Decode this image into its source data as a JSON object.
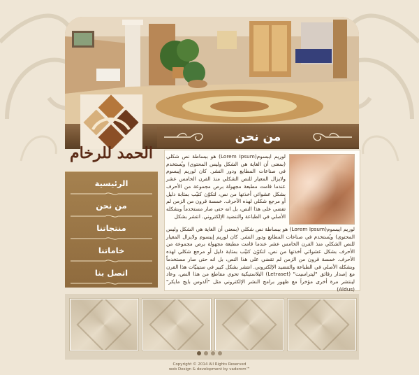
{
  "site": {
    "logo_text": "الحمد للرخام",
    "section_title": "من نحن"
  },
  "menu": {
    "items": [
      {
        "label": "الرئيسية"
      },
      {
        "label": "من نحن"
      },
      {
        "label": "منتجاتنا"
      },
      {
        "label": "خاماتنا"
      },
      {
        "label": "اتصل بنا"
      }
    ]
  },
  "content": {
    "paragraph1": "لوريم ايبسوم(Lorem Ipsum) هو ببساطة نص شكلي (بمعنى أن الغاية هي الشكل وليس المحتوى) ويُستخدم في صناعات المطابع ودور النشر. كان لوريم إيبسوم ولايزال المعيار للنص الشكلي منذ القرن الخامس عشر عندما قامت مطبعة مجهولة برص مجموعة من الأحرف بشكل عشوائي أخذتها من نص، لتكوّن كتيّب بمثابة دليل أو مرجع شكلي لهذه الأحرف. خمسة قرون من الزمن لم تقضي على هذا النص، بل انه حتى صار مستخدماً وبشكله الأصلي في الطباعة والتنضيد الإلكتروني. انتشر بشكل",
    "paragraph2": "لوريم ايبسوم(Lorem Ipsum) هو ببساطة نص شكلي (بمعنى أن الغاية هي الشكل وليس المحتوى) ويُستخدم في صناعات المطابع ودور النشر. كان لوريم إيبسوم ولايزال المعيار للنص الشكلي منذ القرن الخامس عشر عندما قامت مطبعة مجهولة برص مجموعة من الأحرف بشكل عشوائي أخذتها من نص، لتكوّن كتيّب بمثابة دليل أو مرجع شكلي لهذه الأحرف. خمسة قرون من الزمن لم تقضي على هذا النص، بل انه حتى صار مستخدماً وبشكله الأصلي في الطباعة والتنضيد الإلكتروني. انتشر بشكل كبير في ستينيّات هذا القرن مع إصدار رقائق \"ليتراسيت\" (Letraset) البلاستيكية تحوي مقاطع من هذا النص، وعاد لينتشر مرة أخرى مؤخراَ مع ظهور برامج النشر الإلكتروني مثل \"ألدوس بايج مايكر\" (Aldus)"
  },
  "footer": {
    "copyright": "Copyright © 2014 All Rights Reserved",
    "credit": "web Design & development by vaderom™"
  },
  "colors": {
    "background": "#efe6d6",
    "band": "#6f4f30",
    "menu": "#9a7646",
    "logo_text": "#5a2a16"
  },
  "icons": [
    "logo-mark-icon",
    "flourish-left-icon",
    "flourish-right-icon",
    "menu-separator-icon"
  ]
}
